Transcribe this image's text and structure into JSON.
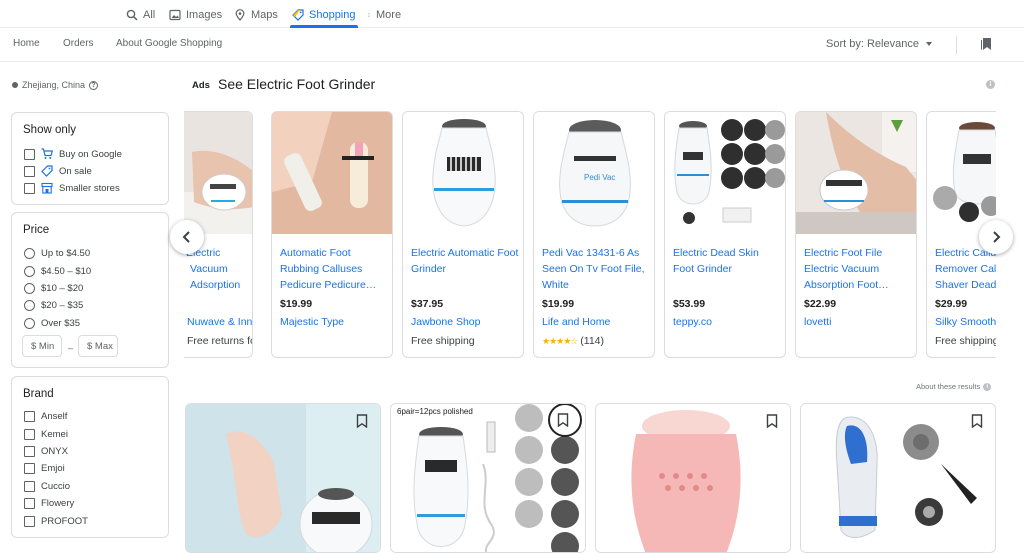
{
  "top_tabs": [
    {
      "label": "All",
      "icon": "search-icon"
    },
    {
      "label": "Images",
      "icon": "image-icon"
    },
    {
      "label": "Maps",
      "icon": "map-pin-icon"
    },
    {
      "label": "Shopping",
      "icon": "tag-icon",
      "active": true
    },
    {
      "label": "More",
      "icon": "more-vert-icon"
    }
  ],
  "subnav": {
    "home": "Home",
    "orders": "Orders",
    "about": "About Google Shopping",
    "sort_label": "Sort by: Relevance"
  },
  "sidebar": {
    "location": "Zhejiang, China",
    "show_only": {
      "title": "Show only",
      "items": [
        "Buy on Google",
        "On sale",
        "Smaller stores"
      ]
    },
    "price": {
      "title": "Price",
      "options": [
        "Up to $4.50",
        "$4.50 – $10",
        "$10 – $20",
        "$20 – $35",
        "Over $35"
      ],
      "min_placeholder": "$ Min",
      "max_placeholder": "$ Max",
      "dash": "–"
    },
    "brand": {
      "title": "Brand",
      "items": [
        "Anself",
        "Kemei",
        "ONYX",
        "Emjoi",
        "Cuccio",
        "Flowery",
        "PROFOOT"
      ]
    }
  },
  "ads": {
    "label": "Ads",
    "title": "See Electric Foot Grinder",
    "info": "i",
    "cards": [
      {
        "title": "Electric Vacuum Adsorption Foot Grinder",
        "price": "",
        "store": "Nuwave & Innovate",
        "extra": "Free returns for m…",
        "partial": true
      },
      {
        "title": "Automatic Foot Rubbing Calluses Pedicure Pedicure…",
        "price": "$19.99",
        "store": "Majestic Type",
        "extra": ""
      },
      {
        "title": "Electric Automatic Foot Grinder",
        "price": "$37.95",
        "store": "Jawbone Shop",
        "extra": "Free shipping"
      },
      {
        "title": "Pedi Vac 13431-6 As Seen On Tv Foot File, White",
        "price": "$19.99",
        "store": "Life and Home",
        "rating": "★★★★☆",
        "reviews": "(114)"
      },
      {
        "title": "Electric Dead Skin Foot Grinder",
        "price": "$53.99",
        "store": "teppy.co",
        "extra": ""
      },
      {
        "title": "Electric Foot File Electric Vacuum Absorption Foot…",
        "price": "$22.99",
        "store": "lovetti",
        "extra": ""
      },
      {
        "title": "Electric Callus Remover Callus Shaver Dead Skin",
        "price": "$29.99",
        "store": "Silky Smooth",
        "extra": "Free shipping"
      }
    ],
    "about_results": "About these results"
  },
  "grid": {
    "polished_text": "6pair=12pcs polished"
  },
  "colors": {
    "accent": "#1a73e8",
    "text": "#202124",
    "muted": "#5f6368",
    "border": "#dadce0",
    "star": "#f4b400"
  }
}
